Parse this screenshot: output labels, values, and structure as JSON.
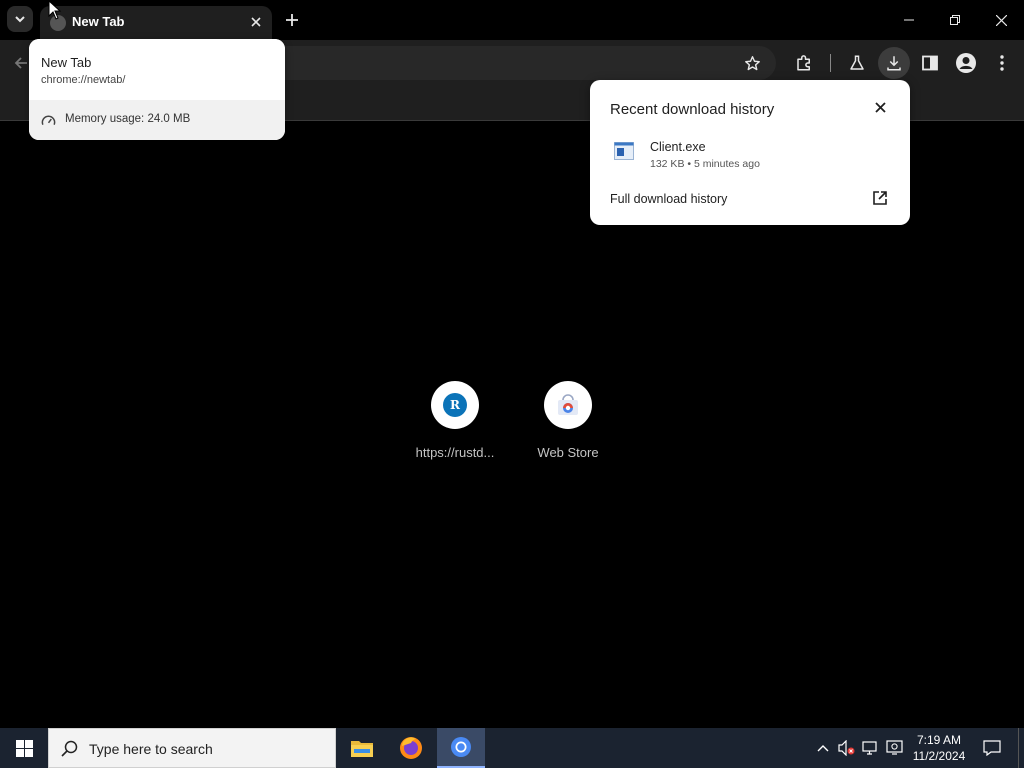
{
  "tabstrip": {
    "active_tab_title": "New Tab"
  },
  "hovercard": {
    "title": "New Tab",
    "url": "chrome://newtab/",
    "memory": "Memory usage: 24.0 MB"
  },
  "download_bubble": {
    "title": "Recent download history",
    "item": {
      "filename": "Client.exe",
      "details": "132 KB • 5 minutes ago"
    },
    "full_history_label": "Full download history"
  },
  "shortcuts": [
    {
      "label": "https://rustd...",
      "letter": "R"
    },
    {
      "label": "Web Store"
    }
  ],
  "taskbar": {
    "search_placeholder": "Type here to search",
    "time": "7:19 AM",
    "date": "11/2/2024"
  },
  "colors": {
    "shortcut_letter_bg": "#0b73b8",
    "taskbar_bg": "#1b2330",
    "toolbar_bg": "#1f1f1f"
  }
}
